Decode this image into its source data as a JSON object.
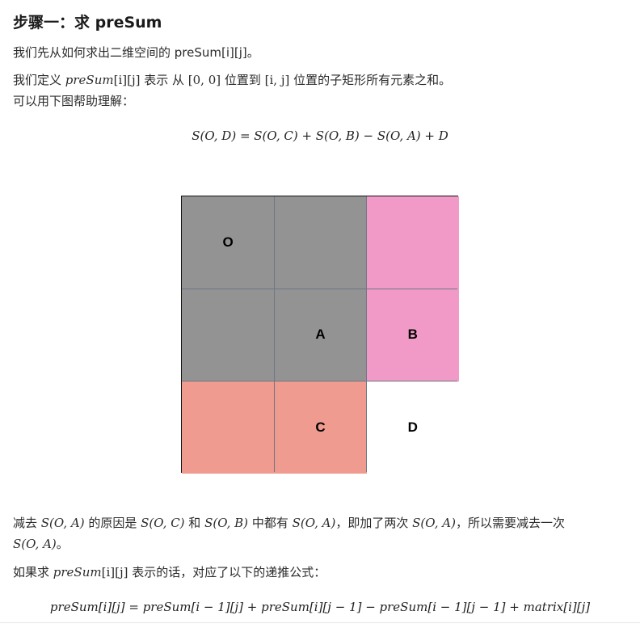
{
  "heading": "步骤一：求 preSum",
  "p1": "我们先从如何求出二维空间的 preSum[i][j]。",
  "p2": {
    "t1": "我们定义 ",
    "var": "preSum",
    "idx": "[i][j]",
    "t2": " 表示 从 ",
    "r1": "[0, 0]",
    "t3": " 位置到 ",
    "r2": "[i, j]",
    "t4": " 位置的子矩形所有元素之和。"
  },
  "p3": "可以用下图帮助理解：",
  "formula1": "S(O, D) = S(O, C) + S(O, B) − S(O, A) + D",
  "grid": {
    "colors": {
      "gray": "#939393",
      "pink": "#f19ac7",
      "salmon": "#ef9b8f",
      "white": "#ffffff"
    },
    "cells": [
      [
        "O",
        "",
        ""
      ],
      [
        "",
        "A",
        "B"
      ],
      [
        "",
        "C",
        "D"
      ]
    ]
  },
  "p4": {
    "t1": "减去 ",
    "s1": "S(O, A)",
    "t2": " 的原因是 ",
    "s2": "S(O, C)",
    "t3": " 和 ",
    "s3": "S(O, B)",
    "t4": " 中都有 ",
    "s4": "S(O, A)",
    "t5": "，即加了两次 ",
    "s5": "S(O, A)",
    "t6": "，所以需要减去一次",
    "s6": "S(O, A)",
    "t7": "。"
  },
  "p5": {
    "t1": "如果求 ",
    "var": "preSum",
    "idx": "[i][j]",
    "t2": " 表示的话，对应了以下的递推公式："
  },
  "formula2": "preSum[i][j] = preSum[i − 1][j] + preSum[i][j − 1] − preSum[i − 1][j − 1] + matrix[i][j]"
}
